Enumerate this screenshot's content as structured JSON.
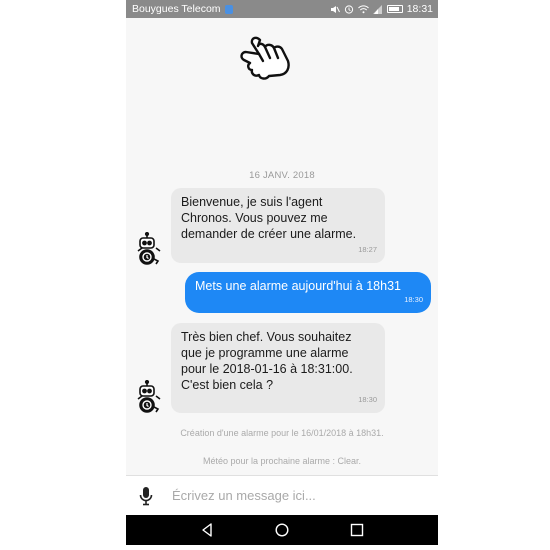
{
  "status_bar": {
    "carrier": "Bouygues Telecom",
    "time": "18:31",
    "icons": [
      "sim-card-icon",
      "mute-icon",
      "alarm-icon",
      "wifi-icon",
      "signal-icon",
      "battery-icon"
    ]
  },
  "chat": {
    "date_separator": "16 JANV. 2018",
    "messages": [
      {
        "sender": "bot",
        "text": "Bienvenue, je suis l'agent Chronos. Vous pouvez me demander de créer une alarme.",
        "time": "18:27"
      },
      {
        "sender": "user",
        "text": "Mets une alarme aujourd'hui à 18h31",
        "time": "18:30"
      },
      {
        "sender": "bot",
        "text": "Très bien chef. Vous souhaitez que je programme une alarme pour le 2018-01-16 à 18:31:00. C'est bien cela ?",
        "time": "18:30"
      }
    ],
    "notices": [
      "Création d'une alarme pour le 16/01/2018 à 18h31.",
      "Météo pour la prochaine alarme : Clear."
    ]
  },
  "input": {
    "placeholder": "Écrivez un message ici..."
  },
  "colors": {
    "accent": "#1e88f5",
    "bot_bubble": "#e9e9e9",
    "status_bar": "#8a8a8a"
  },
  "nav_bar": {
    "buttons": [
      "back-icon",
      "home-icon",
      "recents-icon"
    ]
  }
}
